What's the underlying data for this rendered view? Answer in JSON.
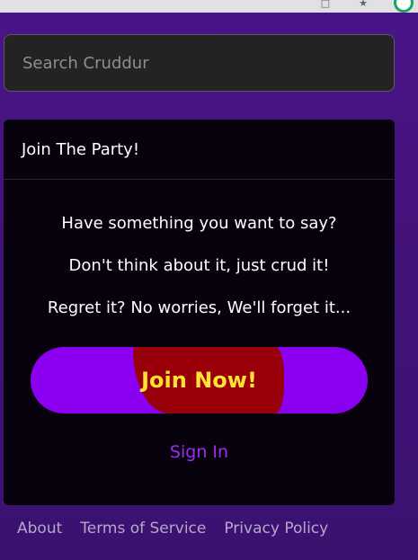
{
  "search": {
    "placeholder": "Search Cruddur",
    "value": ""
  },
  "card": {
    "title": "Join The Party!",
    "taglines": [
      "Have something you want to say?",
      "Don't think about it, just crud it!",
      "Regret it? No worries, We'll forget it..."
    ],
    "join_label": "Join Now!",
    "signin_label": "Sign In"
  },
  "footer": {
    "links": [
      "About",
      "Terms of Service",
      "Privacy Policy"
    ]
  },
  "colors": {
    "page_background": "#45127d",
    "card_background": "#07020e",
    "join_button": "#8b00f0",
    "join_highlight": "#99000a",
    "join_text": "#ffe234",
    "signin_link": "#9e2cf0",
    "footer_link": "#b7a8c8"
  },
  "icons": {
    "browser_restore": "restore-icon",
    "browser_star": "star-icon",
    "browser_extension": "extension-icon"
  }
}
